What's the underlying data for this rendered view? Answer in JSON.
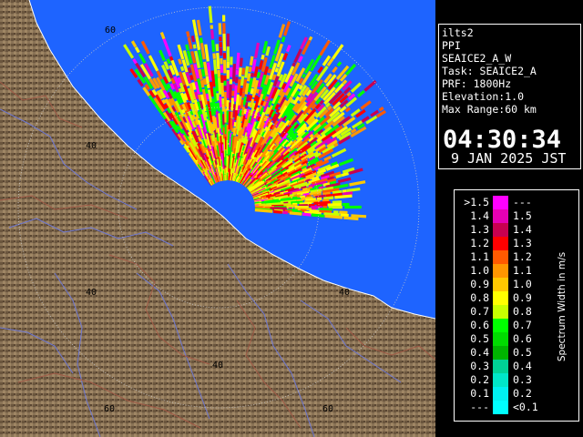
{
  "info": {
    "lines": [
      "ilts2",
      "PPI",
      "SEAICE2_A_W",
      "Task: SEAICE2_A",
      "PRF: 1800Hz",
      "Elevation:1.0",
      "Max Range:60 km"
    ],
    "time": "04:30:34",
    "date": "9 JAN 2025 JST"
  },
  "range_labels": {
    "r60_a": "60",
    "r40_a": "40",
    "r40_b": "40",
    "r40_c": "40",
    "r40_d": "40",
    "r60_b": "60",
    "r60_c": "60"
  },
  "legend": {
    "title": "Spectrum Width in m/s",
    "entries": [
      {
        "left": ">1.5",
        "right": "---",
        "color": "#ff00ff"
      },
      {
        "left": "1.4",
        "right": "1.5",
        "color": "#e600b4"
      },
      {
        "left": "1.3",
        "right": "1.4",
        "color": "#c80050"
      },
      {
        "left": "1.2",
        "right": "1.3",
        "color": "#ff0000"
      },
      {
        "left": "1.1",
        "right": "1.2",
        "color": "#ff5a00"
      },
      {
        "left": "1.0",
        "right": "1.1",
        "color": "#ff9600"
      },
      {
        "left": "0.9",
        "right": "1.0",
        "color": "#ffc800"
      },
      {
        "left": "0.8",
        "right": "0.9",
        "color": "#ffff00"
      },
      {
        "left": "0.7",
        "right": "0.8",
        "color": "#c8ff00"
      },
      {
        "left": "0.6",
        "right": "0.7",
        "color": "#00ff00"
      },
      {
        "left": "0.5",
        "right": "0.6",
        "color": "#00dc00"
      },
      {
        "left": "0.4",
        "right": "0.5",
        "color": "#00b400"
      },
      {
        "left": "0.3",
        "right": "0.4",
        "color": "#00d296"
      },
      {
        "left": "0.2",
        "right": "0.3",
        "color": "#00e6c8"
      },
      {
        "left": "0.1",
        "right": "0.2",
        "color": "#00f0f0"
      },
      {
        "left": "---",
        "right": "<0.1",
        "color": "#00ffff"
      }
    ]
  },
  "colors": {
    "sea": "#1e64ff",
    "land": "#8a7356",
    "rivers": "#6e78d2",
    "borders": "#a05a46",
    "range_rings": "#c8c8c8"
  }
}
